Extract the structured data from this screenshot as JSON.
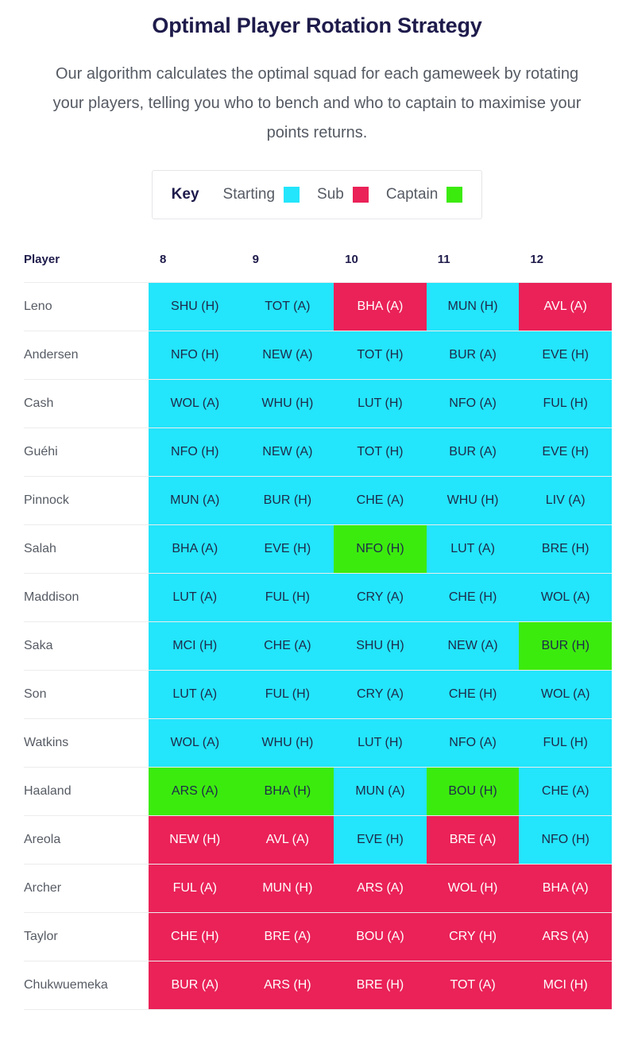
{
  "header": {
    "title": "Optimal Player Rotation Strategy",
    "subtitle": "Our algorithm calculates the optimal squad for each gameweek by rotating your players, telling you who to bench and who to captain to maximise your points returns."
  },
  "key": {
    "label": "Key",
    "items": [
      {
        "label": "Starting",
        "status": "starting",
        "color": "#23e5fb"
      },
      {
        "label": "Sub",
        "status": "sub",
        "color": "#ea2258"
      },
      {
        "label": "Captain",
        "status": "captain",
        "color": "#3ceb0e"
      }
    ]
  },
  "palette": {
    "starting": {
      "bg": "#23e5fb",
      "fg": "#1e2a4a"
    },
    "sub": {
      "bg": "#ea2258",
      "fg": "#ffffff"
    },
    "captain": {
      "bg": "#3ceb0e",
      "fg": "#1e2a4a"
    }
  },
  "table": {
    "columns": [
      "Player",
      "8",
      "9",
      "10",
      "11",
      "12"
    ],
    "player_header": "Player",
    "gameweeks": [
      "8",
      "9",
      "10",
      "11",
      "12"
    ],
    "rows": [
      {
        "player": "Leno",
        "cells": [
          {
            "text": "SHU (H)",
            "status": "starting"
          },
          {
            "text": "TOT (A)",
            "status": "starting"
          },
          {
            "text": "BHA (A)",
            "status": "sub"
          },
          {
            "text": "MUN (H)",
            "status": "starting"
          },
          {
            "text": "AVL (A)",
            "status": "sub"
          }
        ]
      },
      {
        "player": "Andersen",
        "cells": [
          {
            "text": "NFO (H)",
            "status": "starting"
          },
          {
            "text": "NEW (A)",
            "status": "starting"
          },
          {
            "text": "TOT (H)",
            "status": "starting"
          },
          {
            "text": "BUR (A)",
            "status": "starting"
          },
          {
            "text": "EVE (H)",
            "status": "starting"
          }
        ]
      },
      {
        "player": "Cash",
        "cells": [
          {
            "text": "WOL (A)",
            "status": "starting"
          },
          {
            "text": "WHU (H)",
            "status": "starting"
          },
          {
            "text": "LUT (H)",
            "status": "starting"
          },
          {
            "text": "NFO (A)",
            "status": "starting"
          },
          {
            "text": "FUL (H)",
            "status": "starting"
          }
        ]
      },
      {
        "player": "Guéhi",
        "cells": [
          {
            "text": "NFO (H)",
            "status": "starting"
          },
          {
            "text": "NEW (A)",
            "status": "starting"
          },
          {
            "text": "TOT (H)",
            "status": "starting"
          },
          {
            "text": "BUR (A)",
            "status": "starting"
          },
          {
            "text": "EVE (H)",
            "status": "starting"
          }
        ]
      },
      {
        "player": "Pinnock",
        "cells": [
          {
            "text": "MUN (A)",
            "status": "starting"
          },
          {
            "text": "BUR (H)",
            "status": "starting"
          },
          {
            "text": "CHE (A)",
            "status": "starting"
          },
          {
            "text": "WHU (H)",
            "status": "starting"
          },
          {
            "text": "LIV (A)",
            "status": "starting"
          }
        ]
      },
      {
        "player": "Salah",
        "cells": [
          {
            "text": "BHA (A)",
            "status": "starting"
          },
          {
            "text": "EVE (H)",
            "status": "starting"
          },
          {
            "text": "NFO (H)",
            "status": "captain"
          },
          {
            "text": "LUT (A)",
            "status": "starting"
          },
          {
            "text": "BRE (H)",
            "status": "starting"
          }
        ]
      },
      {
        "player": "Maddison",
        "cells": [
          {
            "text": "LUT (A)",
            "status": "starting"
          },
          {
            "text": "FUL (H)",
            "status": "starting"
          },
          {
            "text": "CRY (A)",
            "status": "starting"
          },
          {
            "text": "CHE (H)",
            "status": "starting"
          },
          {
            "text": "WOL (A)",
            "status": "starting"
          }
        ]
      },
      {
        "player": "Saka",
        "cells": [
          {
            "text": "MCI (H)",
            "status": "starting"
          },
          {
            "text": "CHE (A)",
            "status": "starting"
          },
          {
            "text": "SHU (H)",
            "status": "starting"
          },
          {
            "text": "NEW (A)",
            "status": "starting"
          },
          {
            "text": "BUR (H)",
            "status": "captain"
          }
        ]
      },
      {
        "player": "Son",
        "cells": [
          {
            "text": "LUT (A)",
            "status": "starting"
          },
          {
            "text": "FUL (H)",
            "status": "starting"
          },
          {
            "text": "CRY (A)",
            "status": "starting"
          },
          {
            "text": "CHE (H)",
            "status": "starting"
          },
          {
            "text": "WOL (A)",
            "status": "starting"
          }
        ]
      },
      {
        "player": "Watkins",
        "cells": [
          {
            "text": "WOL (A)",
            "status": "starting"
          },
          {
            "text": "WHU (H)",
            "status": "starting"
          },
          {
            "text": "LUT (H)",
            "status": "starting"
          },
          {
            "text": "NFO (A)",
            "status": "starting"
          },
          {
            "text": "FUL (H)",
            "status": "starting"
          }
        ]
      },
      {
        "player": "Haaland",
        "cells": [
          {
            "text": "ARS (A)",
            "status": "captain"
          },
          {
            "text": "BHA (H)",
            "status": "captain"
          },
          {
            "text": "MUN (A)",
            "status": "starting"
          },
          {
            "text": "BOU (H)",
            "status": "captain"
          },
          {
            "text": "CHE (A)",
            "status": "starting"
          }
        ]
      },
      {
        "player": "Areola",
        "cells": [
          {
            "text": "NEW (H)",
            "status": "sub"
          },
          {
            "text": "AVL (A)",
            "status": "sub"
          },
          {
            "text": "EVE (H)",
            "status": "starting"
          },
          {
            "text": "BRE (A)",
            "status": "sub"
          },
          {
            "text": "NFO (H)",
            "status": "starting"
          }
        ]
      },
      {
        "player": "Archer",
        "cells": [
          {
            "text": "FUL (A)",
            "status": "sub"
          },
          {
            "text": "MUN (H)",
            "status": "sub"
          },
          {
            "text": "ARS (A)",
            "status": "sub"
          },
          {
            "text": "WOL (H)",
            "status": "sub"
          },
          {
            "text": "BHA (A)",
            "status": "sub"
          }
        ]
      },
      {
        "player": "Taylor",
        "cells": [
          {
            "text": "CHE (H)",
            "status": "sub"
          },
          {
            "text": "BRE (A)",
            "status": "sub"
          },
          {
            "text": "BOU (A)",
            "status": "sub"
          },
          {
            "text": "CRY (H)",
            "status": "sub"
          },
          {
            "text": "ARS (A)",
            "status": "sub"
          }
        ]
      },
      {
        "player": "Chukwuemeka",
        "cells": [
          {
            "text": "BUR (A)",
            "status": "sub"
          },
          {
            "text": "ARS (H)",
            "status": "sub"
          },
          {
            "text": "BRE (H)",
            "status": "sub"
          },
          {
            "text": "TOT (A)",
            "status": "sub"
          },
          {
            "text": "MCI (H)",
            "status": "sub"
          }
        ]
      }
    ]
  }
}
